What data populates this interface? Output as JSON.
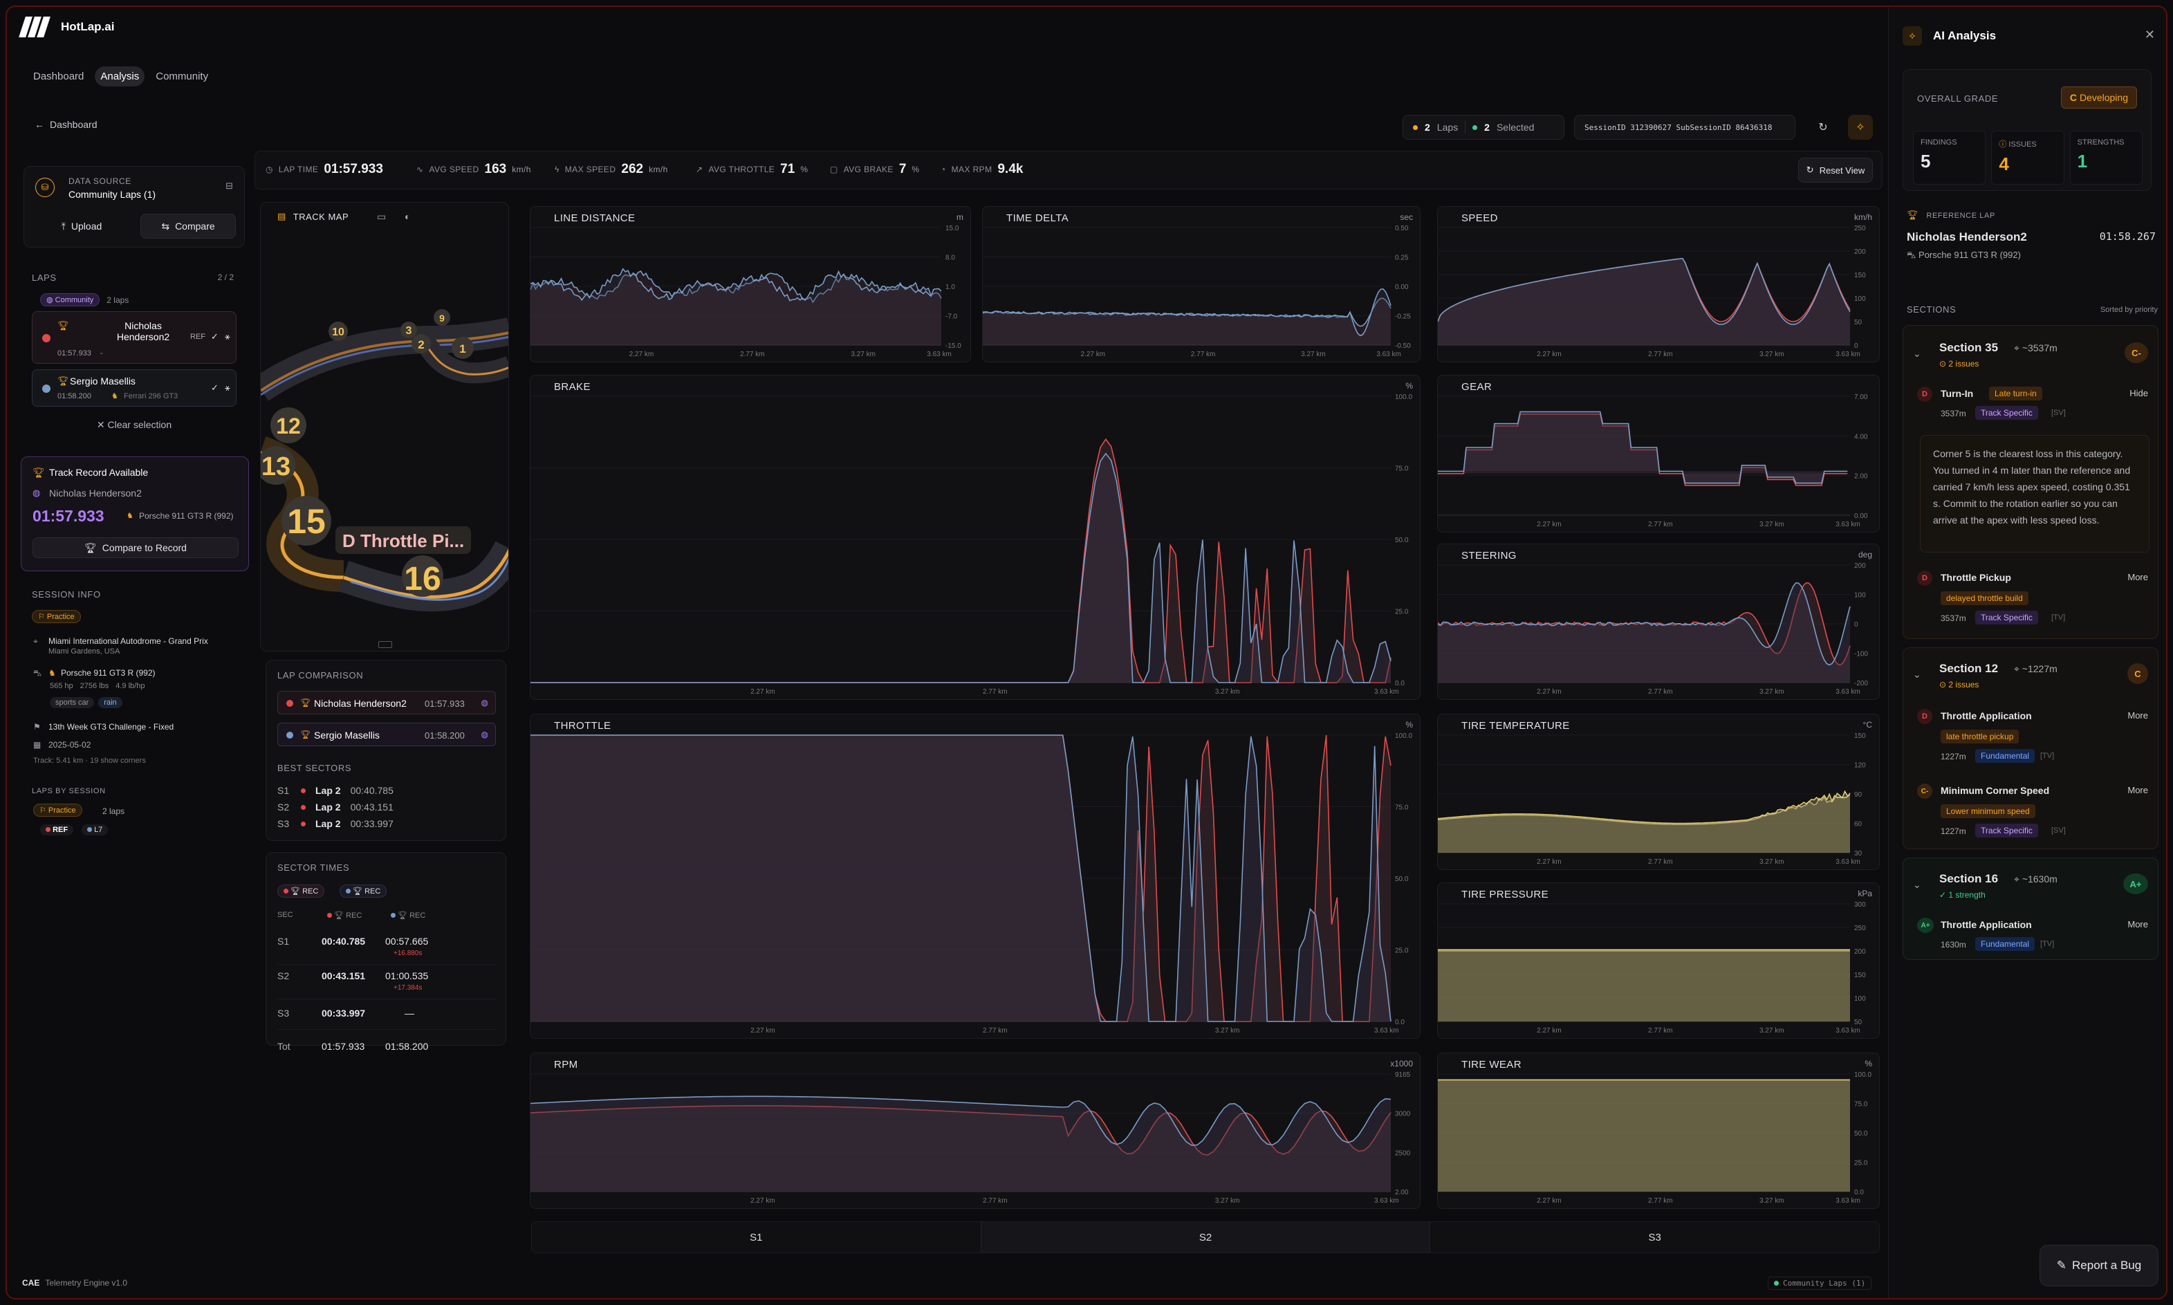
{
  "app": {
    "name": "HotLap.ai"
  },
  "nav": {
    "dashboard": "Dashboard",
    "analysis": "Analysis",
    "community": "Community"
  },
  "back": {
    "label": "Dashboard"
  },
  "header": {
    "laps_count": "2",
    "laps_label": "Laps",
    "selected_count": "2",
    "selected_label": "Selected",
    "session_id": "SessionID 312390627  SubSessionID 86436318"
  },
  "stats": {
    "lap_time_label": "LAP TIME",
    "lap_time": "01:57.933",
    "avg_speed_label": "AVG SPEED",
    "avg_speed": "163",
    "avg_speed_unit": "km/h",
    "max_speed_label": "MAX SPEED",
    "max_speed": "262",
    "max_speed_unit": "km/h",
    "avg_throttle_label": "AVG THROTTLE",
    "avg_throttle": "71",
    "avg_throttle_unit": "%",
    "avg_brake_label": "AVG BRAKE",
    "avg_brake": "7",
    "avg_brake_unit": "%",
    "max_rpm_label": "MAX RPM",
    "max_rpm": "9.4k",
    "reset_view": "Reset View"
  },
  "data_source": {
    "label": "DATA SOURCE",
    "value": "Community Laps (1)",
    "upload": "Upload",
    "compare": "Compare"
  },
  "laps": {
    "label": "LAPS",
    "count": "2 / 2",
    "community_chip": "Community",
    "community_count": "2 laps",
    "items": [
      {
        "name": "Nicholas Henderson2",
        "time": "01:57.933",
        "extra": "-",
        "ref": "REF",
        "color": "#e24b4b"
      },
      {
        "name": "Sergio Masellis",
        "time": "01:58.200",
        "car": "Ferrari 296 GT3",
        "color": "#7a9cc6"
      }
    ],
    "clear": "Clear selection"
  },
  "track_record": {
    "title": "Track Record Available",
    "driver": "Nicholas Henderson2",
    "time": "01:57.933",
    "car": "Porsche 911 GT3 R (992)",
    "button": "Compare to Record"
  },
  "session_info": {
    "label": "SESSION INFO",
    "type": "Practice",
    "track": "Miami International Autodrome - Grand Prix",
    "location": "Miami Gardens, USA",
    "car": "Porsche 911 GT3 R (992)",
    "hp": "565 hp",
    "weight": "2756 lbs",
    "ratio": "4.9 lb/hp",
    "tag1": "sports car",
    "tag2": "rain",
    "series": "13th Week GT3 Challenge - Fixed",
    "date": "2025-05-02",
    "track_meta": "Track: 5.41 km · 19 show corners",
    "laps_by_session": "LAPS BY SESSION",
    "session_chip": "Practice",
    "session_laps": "2 laps",
    "ref_tag": "REF",
    "l7_tag": "L7"
  },
  "track_map": {
    "title": "TRACK MAP",
    "labels": [
      "10",
      "3",
      "9",
      "2",
      "1",
      "12",
      "13",
      "15",
      "16"
    ],
    "overlay": "D Throttle Pi..."
  },
  "lap_comparison": {
    "label": "LAP COMPARISON",
    "rows": [
      {
        "name": "Nicholas Henderson2",
        "time": "01:57.933"
      },
      {
        "name": "Sergio Masellis",
        "time": "01:58.200"
      }
    ],
    "best_label": "BEST SECTORS",
    "best": [
      {
        "s": "S1",
        "lap": "Lap 2",
        "time": "00:40.785"
      },
      {
        "s": "S2",
        "lap": "Lap 2",
        "time": "00:43.151"
      },
      {
        "s": "S3",
        "lap": "Lap 2",
        "time": "00:33.997"
      }
    ]
  },
  "sector_times": {
    "label": "SECTOR TIMES",
    "rec": "REC",
    "sec": "SEC",
    "rows": [
      {
        "s": "S1",
        "a": "00:40.785",
        "b": "00:57.665",
        "d": "+16.880s"
      },
      {
        "s": "S2",
        "a": "00:43.151",
        "b": "01:00.535",
        "d": "+17.384s"
      },
      {
        "s": "S3",
        "a": "00:33.997",
        "b": "—",
        "d": ""
      }
    ],
    "total": {
      "s": "Tot",
      "a": "01:57.933",
      "b": "01:58.200"
    }
  },
  "charts": {
    "line_distance": {
      "title": "LINE DISTANCE",
      "unit": "m",
      "ticks": [
        "15.0",
        "8.0",
        "1.0",
        "-7.0",
        "-15.0"
      ]
    },
    "time_delta": {
      "title": "TIME DELTA",
      "unit": "sec",
      "ticks": [
        "0.50",
        "0.25",
        "0.00",
        "-0.25",
        "-0.50"
      ]
    },
    "speed": {
      "title": "SPEED",
      "unit": "km/h",
      "ticks": [
        "250",
        "200",
        "150",
        "100",
        "50",
        "0"
      ]
    },
    "brake": {
      "title": "BRAKE",
      "unit": "%",
      "ticks": [
        "100.0",
        "75.0",
        "50.0",
        "25.0",
        "0.0"
      ]
    },
    "gear": {
      "title": "GEAR",
      "unit": "",
      "ticks": [
        "7.00",
        "4.00",
        "2.00",
        "0.00"
      ]
    },
    "steering": {
      "title": "STEERING",
      "unit": "deg",
      "ticks": [
        "200",
        "100",
        "0",
        "-100",
        "-200"
      ]
    },
    "throttle": {
      "title": "THROTTLE",
      "unit": "%",
      "ticks": [
        "100.0",
        "75.0",
        "50.0",
        "25.0",
        "0.0"
      ]
    },
    "tire_temp": {
      "title": "TIRE TEMPERATURE",
      "unit": "°C",
      "ticks": [
        "150",
        "120",
        "90",
        "60",
        "30"
      ]
    },
    "tire_pressure": {
      "title": "TIRE PRESSURE",
      "unit": "kPa",
      "ticks": [
        "300",
        "250",
        "200",
        "150",
        "100",
        "50"
      ]
    },
    "rpm": {
      "title": "RPM",
      "unit": "x1000",
      "ticks": [
        "9165",
        "3000",
        "2500",
        "2.00"
      ]
    },
    "tire_wear": {
      "title": "TIRE WEAR",
      "unit": "%",
      "ticks": [
        "100.0",
        "75.0",
        "50.0",
        "25.0",
        "0.0"
      ]
    },
    "x_ticks": [
      "2.27 km",
      "2.77 km",
      "3.27 km",
      "3.63 km"
    ]
  },
  "sectors_bar": [
    "S1",
    "S2",
    "S3"
  ],
  "footer": {
    "brand": "CAE",
    "engine": "Telemetry Engine v1.0",
    "status": "Community Laps (1)"
  },
  "ai": {
    "title": "AI Analysis",
    "overall_label": "OVERALL GRADE",
    "grade": "C",
    "grade_text": "Developing",
    "findings_label": "FINDINGS",
    "findings": "5",
    "issues_label": "ISSUES",
    "issues": "4",
    "strengths_label": "STRENGTHS",
    "strengths": "1",
    "ref_label": "REFERENCE LAP",
    "ref_driver": "Nicholas Henderson2",
    "ref_time": "01:58.267",
    "ref_car": "Porsche 911 GT3 R (992)",
    "sections_label": "SECTIONS",
    "sorted": "Sorted by priority",
    "sections": [
      {
        "name": "Section 35",
        "dist": "~3537m",
        "sub": "2 issues",
        "grade": "C-",
        "items": [
          {
            "grade": "D",
            "title": "Turn-In",
            "tag": "Late turn-in",
            "dist": "3537m",
            "cat": "Track Specific",
            "code": "[SV]",
            "action": "Hide",
            "detail": "Corner 5 is the clearest loss in this category. You turned in 4 m later than the reference and carried 7 km/h less apex speed, costing 0.351 s. Commit to the rotation earlier so you can arrive at the apex with less speed loss."
          },
          {
            "grade": "D",
            "title": "Throttle Pickup",
            "tag": "delayed throttle build",
            "dist": "3537m",
            "cat": "Track Specific",
            "code": "[TV]",
            "action": "More"
          }
        ]
      },
      {
        "name": "Section 12",
        "dist": "~1227m",
        "sub": "2 issues",
        "grade": "C",
        "items": [
          {
            "grade": "D",
            "title": "Throttle Application",
            "tag": "late throttle pickup",
            "dist": "1227m",
            "cat": "Fundamental",
            "code": "[TV]",
            "action": "More"
          },
          {
            "grade": "C-",
            "title": "Minimum Corner Speed",
            "tag": "Lower minimum speed",
            "dist": "1227m",
            "cat": "Track Specific",
            "code": "[SV]",
            "action": "More"
          }
        ]
      },
      {
        "name": "Section 16",
        "dist": "~1630m",
        "sub": "1 strength",
        "grade": "A+",
        "items": [
          {
            "grade": "A+",
            "title": "Throttle Application",
            "tag": "",
            "dist": "1630m",
            "cat": "Fundamental",
            "code": "[TV]",
            "action": "More"
          }
        ]
      }
    ],
    "report_bug": "Report a Bug"
  },
  "colors": {
    "accent": "#f5a623",
    "ref": "#e24b4b",
    "cmp": "#7a9cc6",
    "purple": "#b07cf7"
  }
}
